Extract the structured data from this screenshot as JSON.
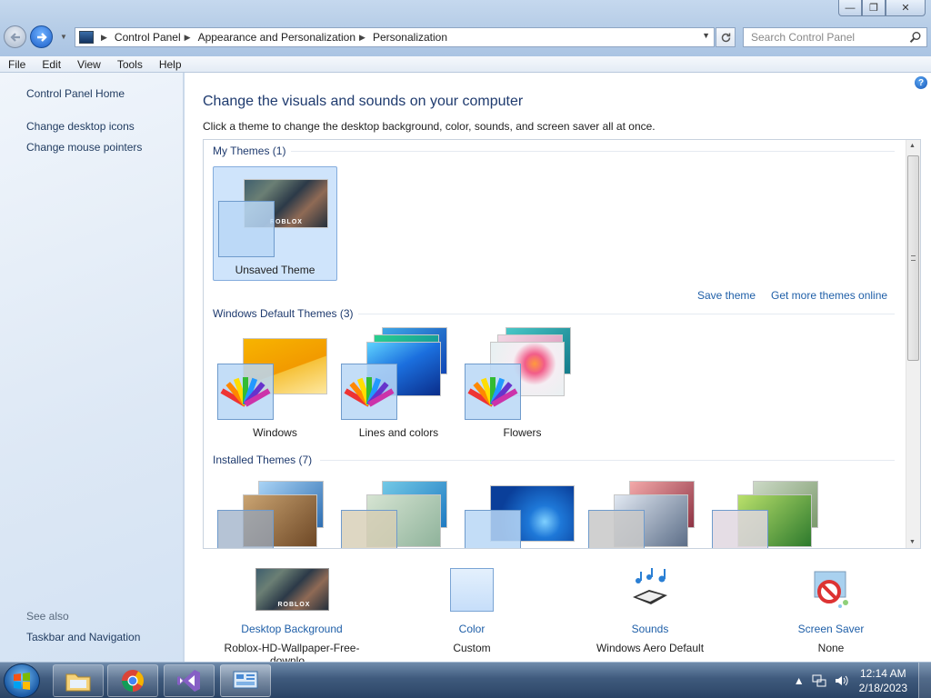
{
  "window": {
    "buttons": {
      "minimize": "—",
      "restore": "❐",
      "close": "✕"
    }
  },
  "address": {
    "crumbs": [
      "Control Panel",
      "Appearance and Personalization",
      "Personalization"
    ]
  },
  "search": {
    "placeholder": "Search Control Panel"
  },
  "menu": [
    "File",
    "Edit",
    "View",
    "Tools",
    "Help"
  ],
  "sidebar": {
    "home": "Control Panel Home",
    "links": [
      "Change desktop icons",
      "Change mouse pointers"
    ],
    "see_also_title": "See also",
    "see_also": [
      "Taskbar and Navigation"
    ]
  },
  "main": {
    "heading": "Change the visuals and sounds on your computer",
    "subheading": "Click a theme to change the desktop background, color, sounds, and screen saver all at once.",
    "groups": {
      "my_themes": "My Themes (1)",
      "default_themes": "Windows Default Themes (3)",
      "installed_themes": "Installed Themes (7)"
    },
    "my_theme_label": "Unsaved Theme",
    "thumb_text": "ROBLOX",
    "save_theme": "Save theme",
    "get_more": "Get more themes online",
    "default_labels": [
      "Windows",
      "Lines and colors",
      "Flowers"
    ]
  },
  "bottom": {
    "background": {
      "label": "Desktop Background",
      "value": "Roblox-HD-Wallpaper-Free-downlo..."
    },
    "color": {
      "label": "Color",
      "value": "Custom"
    },
    "sounds": {
      "label": "Sounds",
      "value": "Windows Aero Default"
    },
    "screensaver": {
      "label": "Screen Saver",
      "value": "None"
    }
  },
  "taskbar": {
    "time": "12:14 AM",
    "date": "2/18/2023"
  },
  "colors": {
    "accent": "#1f5fa8",
    "heading": "#1e3a6e",
    "selection": "#cfe4fb"
  }
}
